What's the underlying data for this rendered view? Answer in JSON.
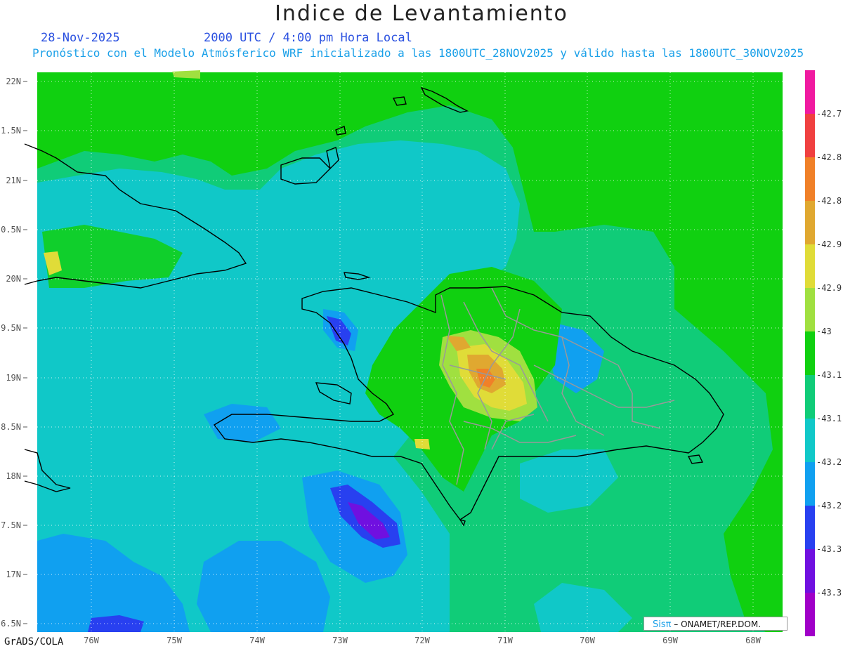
{
  "title": "Indice de Levantamiento",
  "date": "28-Nov-2025",
  "time": "2000 UTC / 4:00 pm Hora Local",
  "description": "Pronóstico con el Modelo Atmósferico WRF inicializado a las 1800UTC_28NOV2025 y válido hasta las  1800UTC_30NOV2025",
  "credit_logo": "Sisπ",
  "credit_text": "– ONAMET/REP.DOM.",
  "footer": "GrADS/COLA",
  "lat_labels": [
    "22N",
    "1.5N",
    "21N",
    "0.5N",
    "20N",
    "9.5N",
    "19N",
    "8.5N",
    "18N",
    "7.5N",
    "17N",
    "6.5N"
  ],
  "lon_labels": [
    "76W",
    "75W",
    "74W",
    "73W",
    "72W",
    "71W",
    "70W",
    "69W",
    "68W"
  ],
  "colorbar": [
    {
      "color": "#f01aa0",
      "label": "-42.7"
    },
    {
      "color": "#f04040",
      "label": "-42.8"
    },
    {
      "color": "#f08028",
      "label": "-42.8"
    },
    {
      "color": "#e0a830",
      "label": "-42.9"
    },
    {
      "color": "#e0dc38",
      "label": "-42.9"
    },
    {
      "color": "#a0e040",
      "label": "-43"
    },
    {
      "color": "#10d010",
      "label": "-43.1"
    },
    {
      "color": "#10cc78",
      "label": "-43.1"
    },
    {
      "color": "#10c8c8",
      "label": "-43.2"
    },
    {
      "color": "#10a0f0",
      "label": "-43.2"
    },
    {
      "color": "#2840f0",
      "label": "-43.3"
    },
    {
      "color": "#7010e0",
      "label": "-43.3"
    },
    {
      "color": "#a000c8",
      "label": ""
    }
  ]
}
